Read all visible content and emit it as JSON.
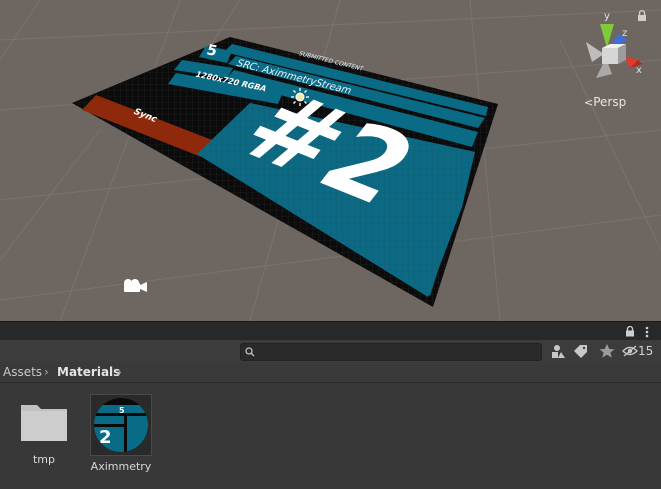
{
  "scene": {
    "view_label": "Persp",
    "gizmo_axes": {
      "y": "y",
      "z": "z",
      "x": "x"
    },
    "board": {
      "badge_number": "5",
      "header_text": "SUBMITTED CONTENT",
      "stream_label": "SRC: AximmetryStream",
      "resolution_label": "1280x720 RGBA",
      "sync_label": "Sync",
      "big_number": "#2"
    },
    "icons": [
      "lock-icon",
      "sun-icon",
      "camera-icon",
      "scene-gizmo-icon"
    ]
  },
  "project_panel": {
    "toolbar": {
      "search_placeholder": "",
      "hidden_count": "15",
      "icons": [
        "search-icon",
        "create-icon",
        "tag-icon",
        "star-icon",
        "eye-hidden-icon",
        "lock-icon",
        "menu-icon"
      ]
    },
    "breadcrumb": [
      "Assets",
      "Materials"
    ],
    "items": [
      {
        "name": "tmp",
        "icon": "folder-icon"
      },
      {
        "name": "Aximmetry",
        "icon": "material-sphere-icon"
      }
    ]
  },
  "colors": {
    "scene_bg": "#6e6661",
    "panel_bg": "#383838",
    "board_teal": "#0a6b86",
    "sync_red": "#8e2a0b"
  }
}
